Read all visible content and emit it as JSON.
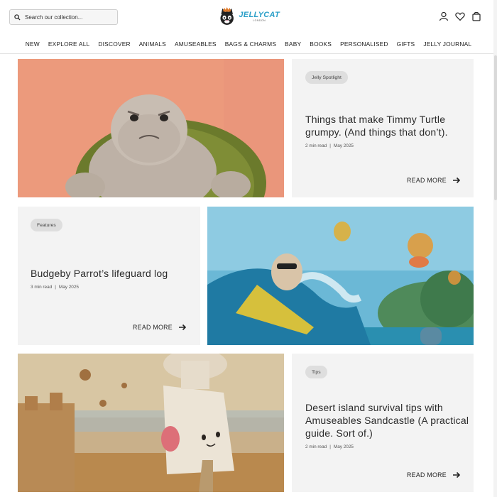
{
  "search": {
    "placeholder": "Search our collection..."
  },
  "brand": {
    "name": "JELLYCAT",
    "sub": "LONDON"
  },
  "nav": {
    "items": [
      "NEW",
      "EXPLORE ALL",
      "DISCOVER",
      "ANIMALS",
      "AMUSEABLES",
      "BAGS & CHARMS",
      "BABY",
      "BOOKS",
      "PERSONALISED",
      "GIFTS",
      "JELLY JOURNAL"
    ]
  },
  "articles": [
    {
      "tag": "Jelly Spotlight",
      "title": "Things that make Timmy Turtle grumpy. (And things that don’t).",
      "read_time": "2 min read",
      "date": "May 2025",
      "cta": "READ MORE"
    },
    {
      "tag": "Features",
      "title": "Budgeby Parrot’s lifeguard log",
      "read_time": "3 min read",
      "date": "May 2025",
      "cta": "READ MORE"
    },
    {
      "tag": "Tips",
      "title": "Desert island survival tips with Amuseables Sandcastle (A practical guide. Sort of.)",
      "read_time": "2 min read",
      "date": "May 2025",
      "cta": "READ MORE"
    }
  ],
  "icons": {
    "search": "search-icon",
    "account": "account-icon",
    "wishlist": "heart-icon",
    "bag": "bag-icon",
    "arrow": "arrow-right-icon"
  },
  "colors": {
    "brand": "#2b9fc8",
    "card_bg": "#f3f3f3",
    "tag_bg": "#dedede",
    "turtle_bg": "#ec9a7c"
  }
}
